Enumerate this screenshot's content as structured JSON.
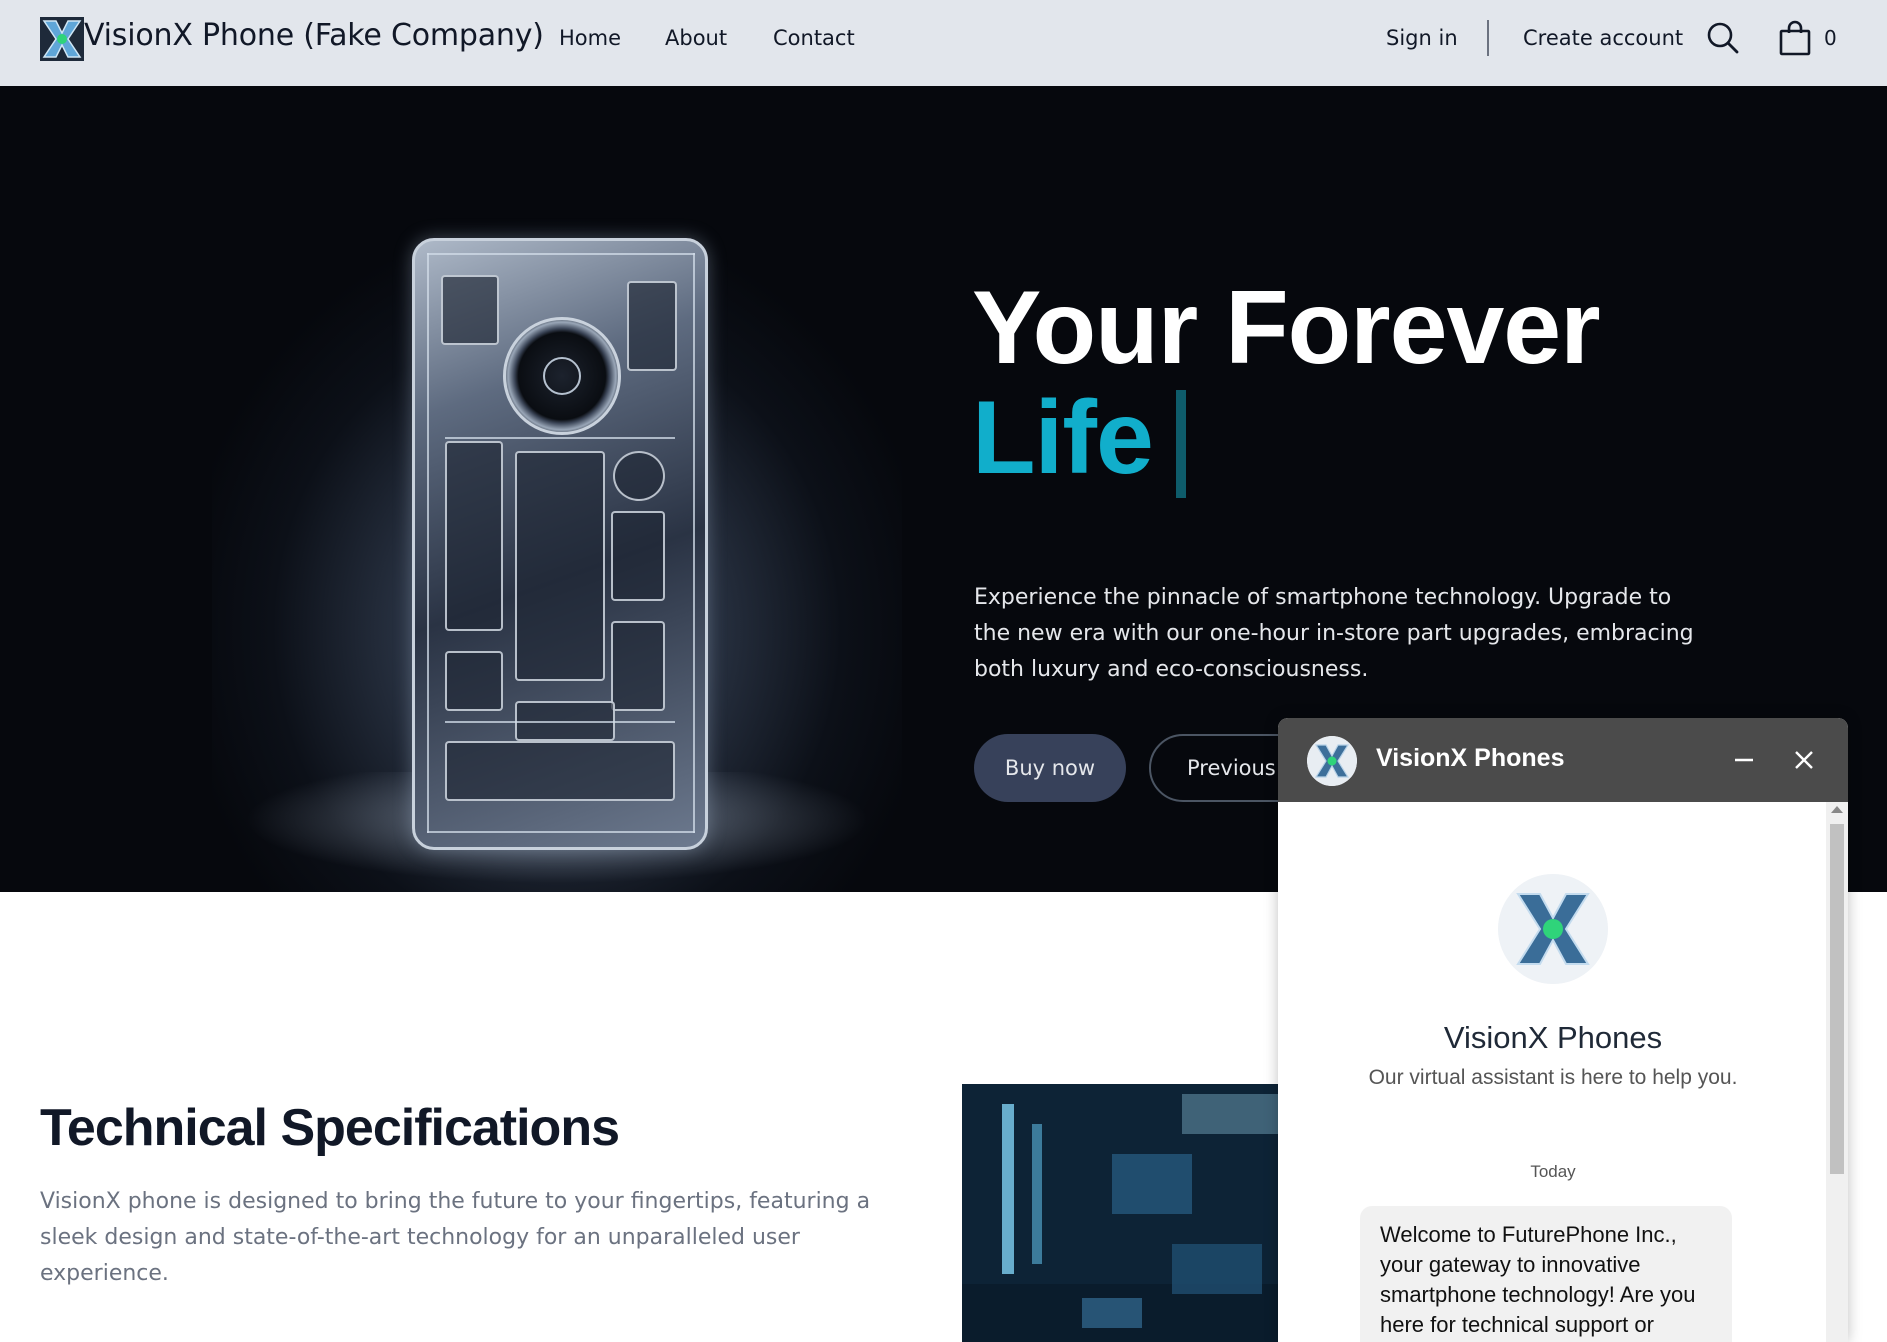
{
  "header": {
    "brand": "VisionX Phone (Fake Company)",
    "nav": [
      {
        "label": "Home"
      },
      {
        "label": "About"
      },
      {
        "label": "Contact"
      }
    ],
    "sign_in": "Sign in",
    "create_account": "Create account",
    "cart_count": "0",
    "icons": [
      "logo-icon",
      "search-icon",
      "cart-icon"
    ]
  },
  "hero": {
    "title_line1": "Your Forever",
    "title_line2": "Life",
    "description": "Experience the pinnacle of smartphone technology. Upgrade to the new era with our one-hour in-store part upgrades, embracing both luxury and eco-consciousness.",
    "buy_button": "Buy now",
    "previous_button": "Previous Models",
    "accent_color": "#11aecb"
  },
  "specs": {
    "title": "Technical Specifications",
    "description": "VisionX phone is designed to bring the future to your fingertips, featuring a sleek design and state-of-the-art technology for an unparalleled user experience."
  },
  "chat": {
    "header_title": "VisionX Phones",
    "assistant_name": "VisionX Phones",
    "assistant_subtitle": "Our virtual assistant is here to help you.",
    "date_label": "Today",
    "welcome_message": "Welcome to FuturePhone Inc., your gateway to innovative smartphone technology! Are you here for technical support or",
    "icons": [
      "minimize-icon",
      "close-icon"
    ]
  }
}
